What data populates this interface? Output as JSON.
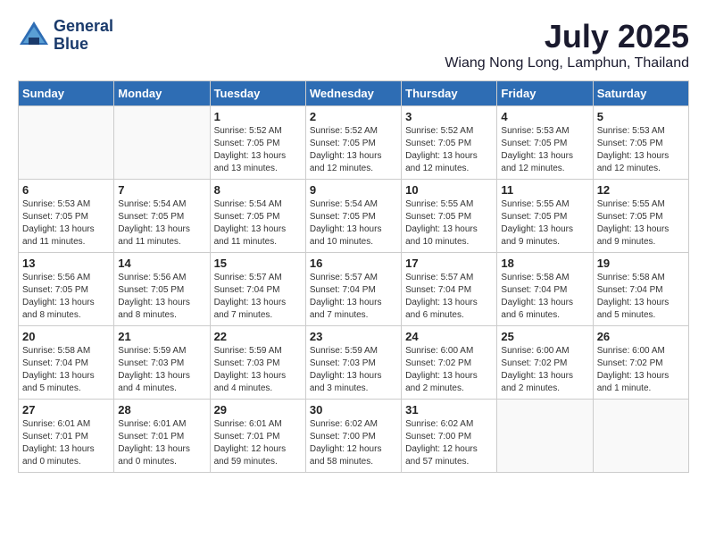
{
  "header": {
    "logo_line1": "General",
    "logo_line2": "Blue",
    "month": "July 2025",
    "location": "Wiang Nong Long, Lamphun, Thailand"
  },
  "weekdays": [
    "Sunday",
    "Monday",
    "Tuesday",
    "Wednesday",
    "Thursday",
    "Friday",
    "Saturday"
  ],
  "weeks": [
    [
      {
        "day": "",
        "info": ""
      },
      {
        "day": "",
        "info": ""
      },
      {
        "day": "1",
        "info": "Sunrise: 5:52 AM\nSunset: 7:05 PM\nDaylight: 13 hours\nand 13 minutes."
      },
      {
        "day": "2",
        "info": "Sunrise: 5:52 AM\nSunset: 7:05 PM\nDaylight: 13 hours\nand 12 minutes."
      },
      {
        "day": "3",
        "info": "Sunrise: 5:52 AM\nSunset: 7:05 PM\nDaylight: 13 hours\nand 12 minutes."
      },
      {
        "day": "4",
        "info": "Sunrise: 5:53 AM\nSunset: 7:05 PM\nDaylight: 13 hours\nand 12 minutes."
      },
      {
        "day": "5",
        "info": "Sunrise: 5:53 AM\nSunset: 7:05 PM\nDaylight: 13 hours\nand 12 minutes."
      }
    ],
    [
      {
        "day": "6",
        "info": "Sunrise: 5:53 AM\nSunset: 7:05 PM\nDaylight: 13 hours\nand 11 minutes."
      },
      {
        "day": "7",
        "info": "Sunrise: 5:54 AM\nSunset: 7:05 PM\nDaylight: 13 hours\nand 11 minutes."
      },
      {
        "day": "8",
        "info": "Sunrise: 5:54 AM\nSunset: 7:05 PM\nDaylight: 13 hours\nand 11 minutes."
      },
      {
        "day": "9",
        "info": "Sunrise: 5:54 AM\nSunset: 7:05 PM\nDaylight: 13 hours\nand 10 minutes."
      },
      {
        "day": "10",
        "info": "Sunrise: 5:55 AM\nSunset: 7:05 PM\nDaylight: 13 hours\nand 10 minutes."
      },
      {
        "day": "11",
        "info": "Sunrise: 5:55 AM\nSunset: 7:05 PM\nDaylight: 13 hours\nand 9 minutes."
      },
      {
        "day": "12",
        "info": "Sunrise: 5:55 AM\nSunset: 7:05 PM\nDaylight: 13 hours\nand 9 minutes."
      }
    ],
    [
      {
        "day": "13",
        "info": "Sunrise: 5:56 AM\nSunset: 7:05 PM\nDaylight: 13 hours\nand 8 minutes."
      },
      {
        "day": "14",
        "info": "Sunrise: 5:56 AM\nSunset: 7:05 PM\nDaylight: 13 hours\nand 8 minutes."
      },
      {
        "day": "15",
        "info": "Sunrise: 5:57 AM\nSunset: 7:04 PM\nDaylight: 13 hours\nand 7 minutes."
      },
      {
        "day": "16",
        "info": "Sunrise: 5:57 AM\nSunset: 7:04 PM\nDaylight: 13 hours\nand 7 minutes."
      },
      {
        "day": "17",
        "info": "Sunrise: 5:57 AM\nSunset: 7:04 PM\nDaylight: 13 hours\nand 6 minutes."
      },
      {
        "day": "18",
        "info": "Sunrise: 5:58 AM\nSunset: 7:04 PM\nDaylight: 13 hours\nand 6 minutes."
      },
      {
        "day": "19",
        "info": "Sunrise: 5:58 AM\nSunset: 7:04 PM\nDaylight: 13 hours\nand 5 minutes."
      }
    ],
    [
      {
        "day": "20",
        "info": "Sunrise: 5:58 AM\nSunset: 7:04 PM\nDaylight: 13 hours\nand 5 minutes."
      },
      {
        "day": "21",
        "info": "Sunrise: 5:59 AM\nSunset: 7:03 PM\nDaylight: 13 hours\nand 4 minutes."
      },
      {
        "day": "22",
        "info": "Sunrise: 5:59 AM\nSunset: 7:03 PM\nDaylight: 13 hours\nand 4 minutes."
      },
      {
        "day": "23",
        "info": "Sunrise: 5:59 AM\nSunset: 7:03 PM\nDaylight: 13 hours\nand 3 minutes."
      },
      {
        "day": "24",
        "info": "Sunrise: 6:00 AM\nSunset: 7:02 PM\nDaylight: 13 hours\nand 2 minutes."
      },
      {
        "day": "25",
        "info": "Sunrise: 6:00 AM\nSunset: 7:02 PM\nDaylight: 13 hours\nand 2 minutes."
      },
      {
        "day": "26",
        "info": "Sunrise: 6:00 AM\nSunset: 7:02 PM\nDaylight: 13 hours\nand 1 minute."
      }
    ],
    [
      {
        "day": "27",
        "info": "Sunrise: 6:01 AM\nSunset: 7:01 PM\nDaylight: 13 hours\nand 0 minutes."
      },
      {
        "day": "28",
        "info": "Sunrise: 6:01 AM\nSunset: 7:01 PM\nDaylight: 13 hours\nand 0 minutes."
      },
      {
        "day": "29",
        "info": "Sunrise: 6:01 AM\nSunset: 7:01 PM\nDaylight: 12 hours\nand 59 minutes."
      },
      {
        "day": "30",
        "info": "Sunrise: 6:02 AM\nSunset: 7:00 PM\nDaylight: 12 hours\nand 58 minutes."
      },
      {
        "day": "31",
        "info": "Sunrise: 6:02 AM\nSunset: 7:00 PM\nDaylight: 12 hours\nand 57 minutes."
      },
      {
        "day": "",
        "info": ""
      },
      {
        "day": "",
        "info": ""
      }
    ]
  ]
}
